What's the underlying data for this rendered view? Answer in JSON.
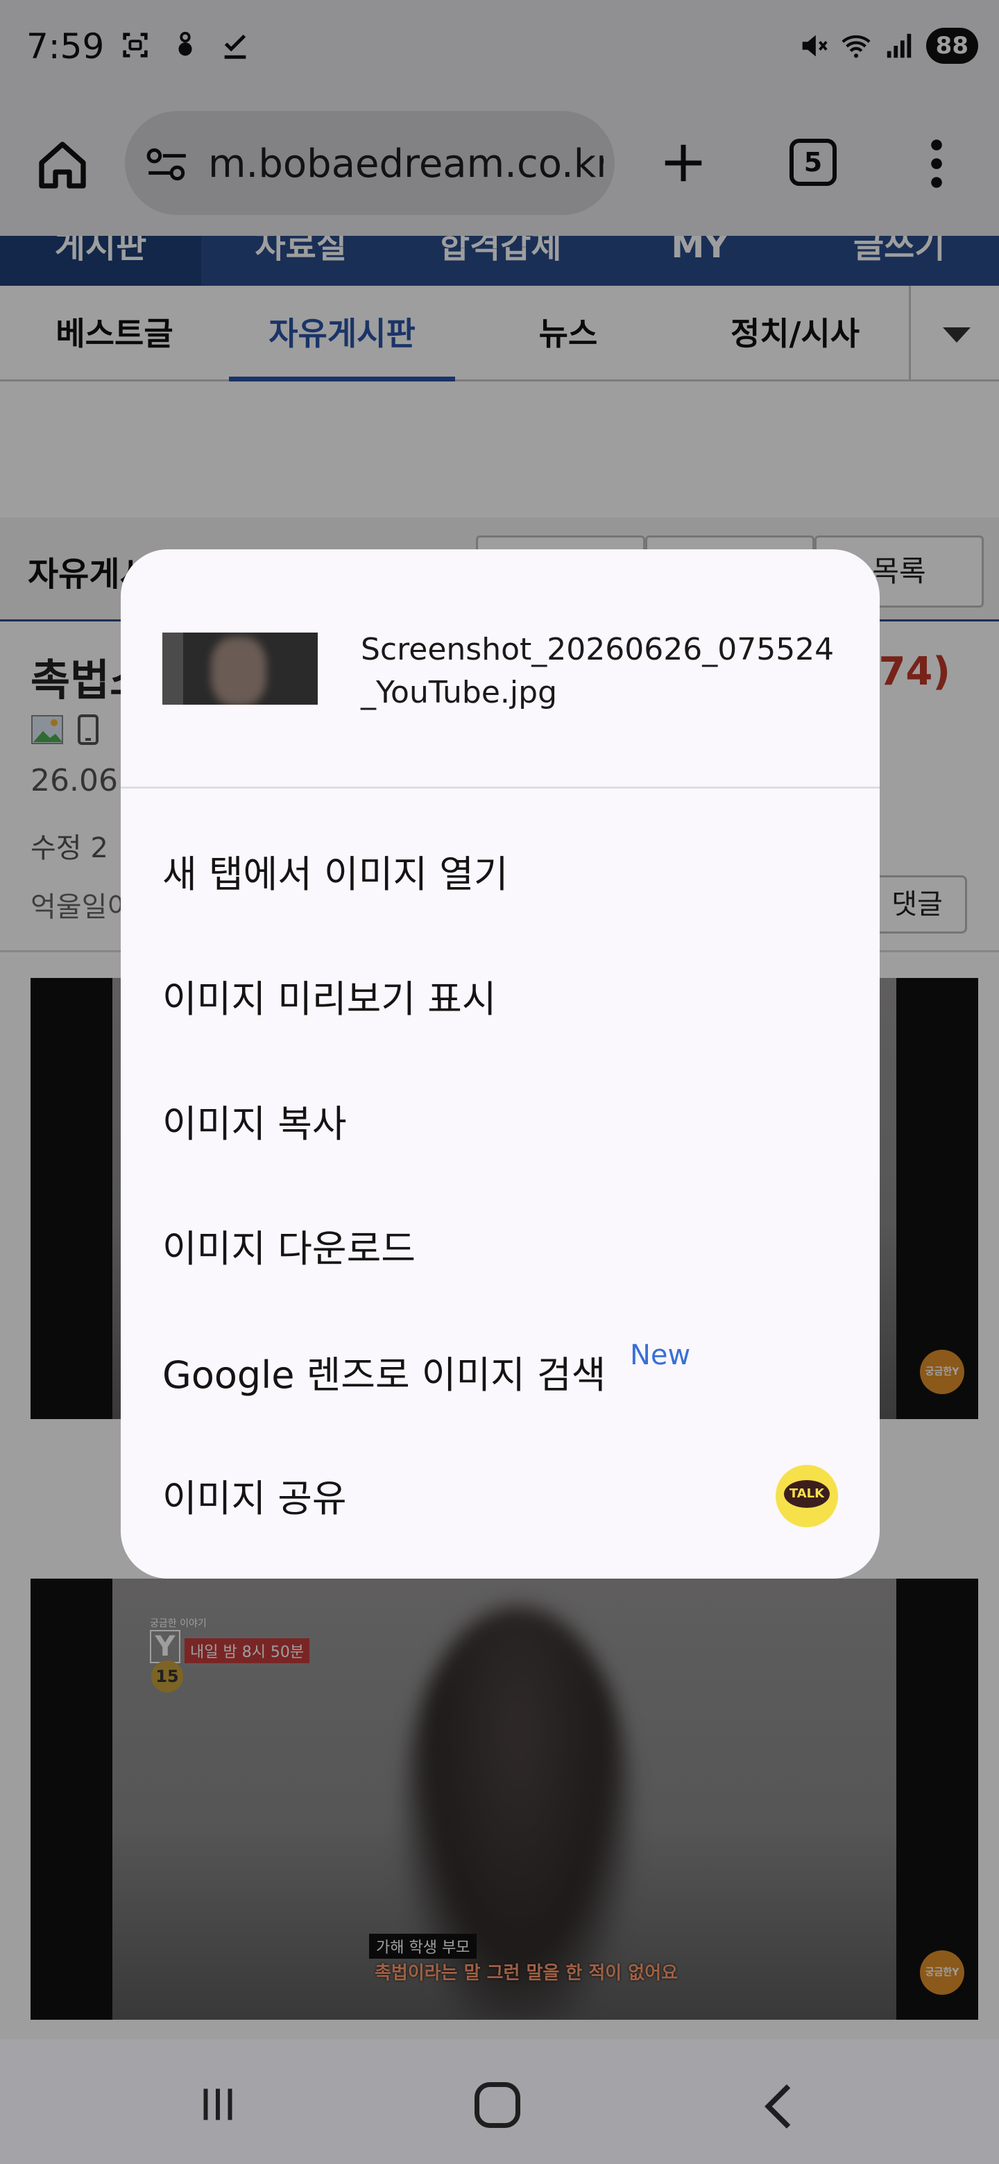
{
  "status_bar": {
    "time": "7:59",
    "icons_left": [
      "screenshot-icon",
      "recorder-icon",
      "checkmark-icon"
    ],
    "icons_right": [
      "vibrate-mute-icon",
      "wifi-icon",
      "signal-icon"
    ],
    "battery": "88"
  },
  "browser": {
    "url": "m.bobaedream.co.kr",
    "tab_count": "5"
  },
  "site": {
    "top_nav": [
      "게시판",
      "자료실",
      "합격갑제",
      "MY",
      "글쓰기"
    ],
    "tabs": [
      "베스트글",
      "자유게시판",
      "뉴스",
      "정치/시사"
    ],
    "active_tab": "자유게시판",
    "board_title": "자유게시판",
    "board_buttons": [
      "",
      "",
      "목록"
    ],
    "post_title": "촉법소",
    "post_count": "74)",
    "post_date": "26.06.",
    "post_edit": "수정 2",
    "post_lead": "억울일이",
    "comment_button": "댓글",
    "video_badge": "궁금한Y",
    "video2": {
      "show": "Y",
      "show_small": "궁금한 이야기",
      "airtime": "내일 밤 8시 50분",
      "rating": "15",
      "speaker": "가해 학생 부모",
      "subtitle": "촉법이라는 말 그런 말을 한 적이 없어요"
    }
  },
  "context_menu": {
    "file_name": "Screenshot_20260626_075524_YouTube.jpg",
    "items": [
      "새 탭에서 이미지 열기",
      "이미지 미리보기 표시",
      "이미지 복사",
      "이미지 다운로드",
      "Google 렌즈로 이미지 검색",
      "이미지 공유"
    ],
    "new_badge": "New",
    "share_app": "TALK",
    "share_app_color": "#f6e14b"
  },
  "colors": {
    "site_blue": "#2a4d8a",
    "active_tab": "#2a55a8",
    "count_red": "#c0392b",
    "new_badge": "#3a6fd8"
  }
}
